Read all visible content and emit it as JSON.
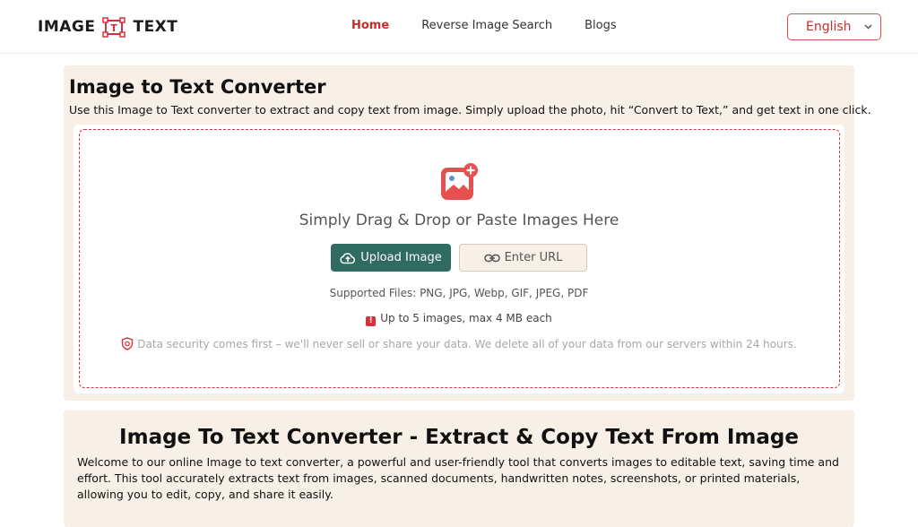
{
  "header": {
    "logo_left": "IMAGE",
    "logo_mark": "T",
    "logo_right": "TEXT",
    "nav": [
      {
        "label": "Home",
        "active": true
      },
      {
        "label": "Reverse Image Search",
        "active": false
      },
      {
        "label": "Blogs",
        "active": false
      }
    ],
    "language": "English"
  },
  "converter": {
    "title": "Image to Text Converter",
    "intro": "Use this Image to Text converter to extract and copy text from image. Simply upload the photo, hit “Convert to Text,” and get text in one click.",
    "drop_title": "Simply Drag & Drop or Paste Images Here",
    "upload_label": "Upload Image",
    "url_label": "Enter URL",
    "supported": "Supported Files: PNG, JPG, Webp, GIF, JPEG, PDF",
    "limit": "Up to 5 images, max 4 MB each",
    "warn_glyph": "!",
    "security": "Data security comes first – we'll never sell or share your data. We delete all of your data from our servers within 24 hours."
  },
  "about": {
    "title": "Image To Text Converter - Extract & Copy Text From Image",
    "paragraph": "Welcome to our online Image to text converter, a powerful and user-friendly tool that converts images to editable text, saving time and effort. This tool accurately extracts text from images, scanned documents, handwritten notes, screenshots, or printed materials, allowing you to edit, copy, and share it easily."
  },
  "colors": {
    "accent_red": "#d6303a",
    "upload_green": "#2f6b5e",
    "card_bg": "#f8efe6"
  },
  "icons": [
    "logo-mark-icon",
    "chevron-down-icon",
    "add-image-icon",
    "cloud-upload-icon",
    "link-icon",
    "warning-icon",
    "shield-icon"
  ]
}
